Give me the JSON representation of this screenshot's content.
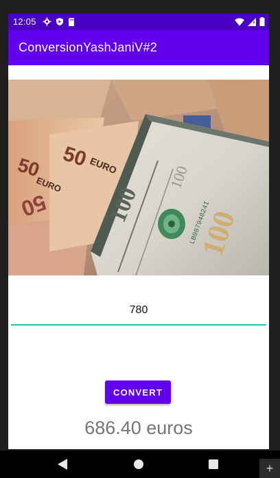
{
  "status_bar": {
    "time": "12:05",
    "left_icons": [
      "gear-icon",
      "shield-icon",
      "sd-card-icon"
    ],
    "right_icons": [
      "wifi-icon",
      "signal-icon",
      "battery-icon"
    ]
  },
  "app_bar": {
    "title": "ConversionYashJaniV#2",
    "color": "#6200ee"
  },
  "hero_image": {
    "description_icon": "currency-banknotes-image"
  },
  "form": {
    "amount_value": "780",
    "convert_label": "CONVERT",
    "result_text": "686.40 euros",
    "accent_color": "#22c4b8"
  },
  "nav_bar": {
    "buttons": [
      "back-icon",
      "home-icon",
      "recents-icon"
    ]
  },
  "side_button": {
    "label": "+"
  }
}
